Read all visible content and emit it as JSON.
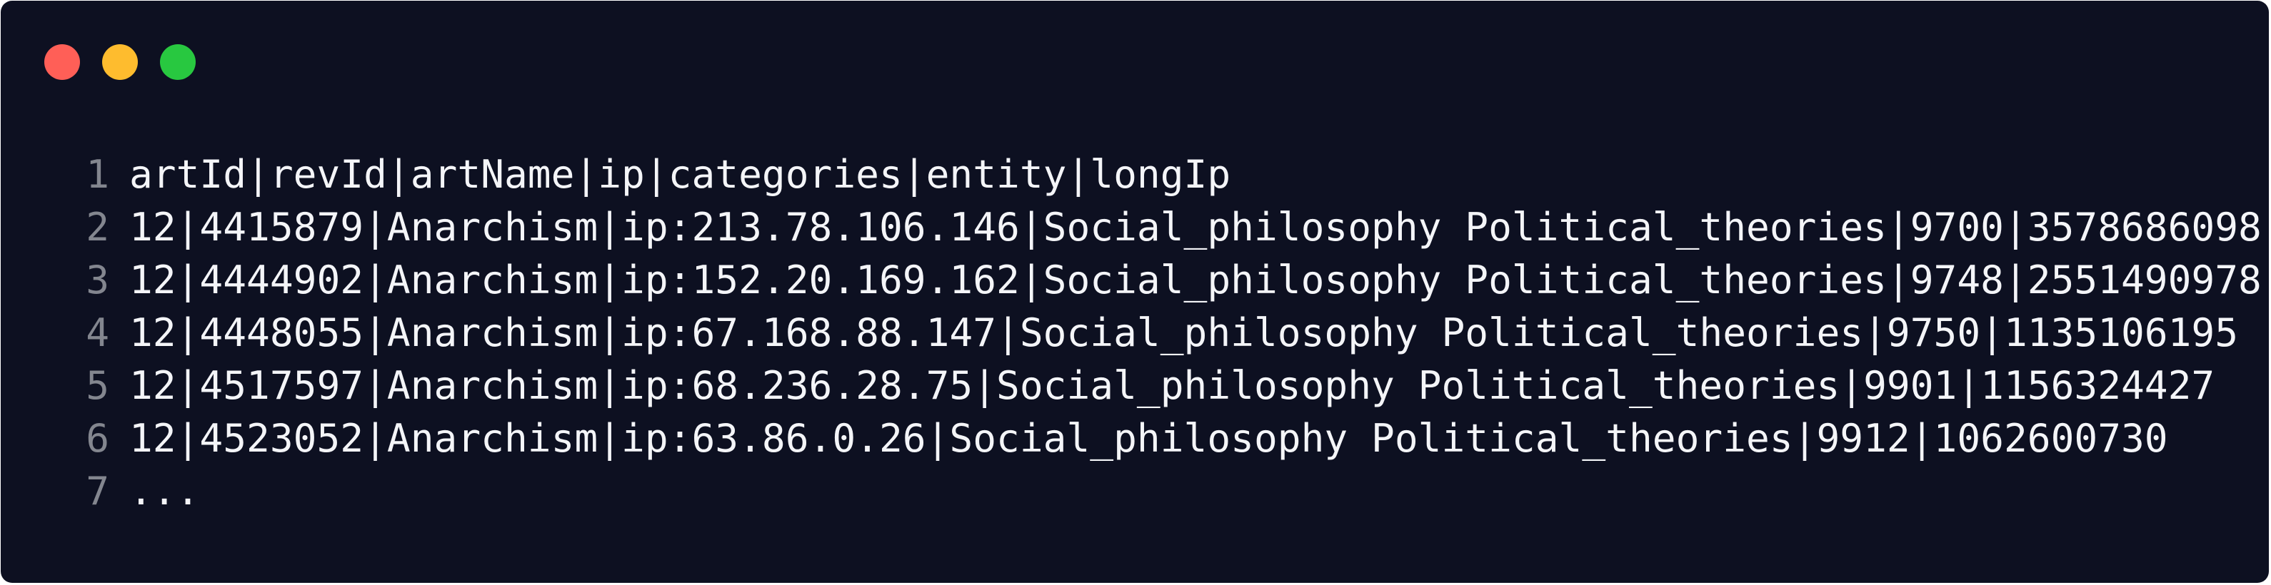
{
  "window": {
    "traffic_lights": [
      {
        "name": "close",
        "color": "#ff5f57"
      },
      {
        "name": "minimize",
        "color": "#febc2e"
      },
      {
        "name": "maximize",
        "color": "#28c840"
      }
    ]
  },
  "code": {
    "lines": [
      {
        "number": "1",
        "text": "artId|revId|artName|ip|categories|entity|longIp"
      },
      {
        "number": "2",
        "text": "12|4415879|Anarchism|ip:213.78.106.146|Social_philosophy Political_theories|9700|3578686098"
      },
      {
        "number": "3",
        "text": "12|4444902|Anarchism|ip:152.20.169.162|Social_philosophy Political_theories|9748|2551490978"
      },
      {
        "number": "4",
        "text": "12|4448055|Anarchism|ip:67.168.88.147|Social_philosophy Political_theories|9750|1135106195"
      },
      {
        "number": "5",
        "text": "12|4517597|Anarchism|ip:68.236.28.75|Social_philosophy Political_theories|9901|1156324427"
      },
      {
        "number": "6",
        "text": "12|4523052|Anarchism|ip:63.86.0.26|Social_philosophy Political_theories|9912|1062600730"
      },
      {
        "number": "7",
        "text": "..."
      }
    ]
  }
}
